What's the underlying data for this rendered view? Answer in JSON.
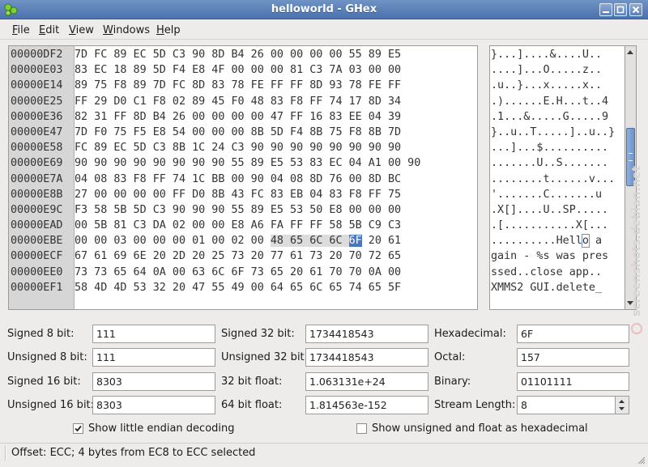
{
  "window": {
    "title": "helloworld - GHex"
  },
  "menu": {
    "file": "File",
    "edit": "Edit",
    "view": "View",
    "windows": "Windows",
    "help": "Help"
  },
  "hex_view": {
    "offsets": [
      "00000DF2",
      "00000E03",
      "00000E14",
      "00000E25",
      "00000E36",
      "00000E47",
      "00000E58",
      "00000E69",
      "00000E7A",
      "00000E8B",
      "00000E9C",
      "00000EAD",
      "00000EBE",
      "00000ECF",
      "00000EE0",
      "00000EF1"
    ],
    "hex_rows": [
      "7D FC 89 EC 5D C3 90 8D B4 26 00 00 00 00 55 89 E5",
      "83 EC 18 89 5D F4 E8 4F 00 00 00 81 C3 7A 03 00 00",
      "89 75 F8 89 7D FC 8D 83 78 FE FF FF 8D 93 78 FE FF",
      "FF 29 D0 C1 F8 02 89 45 F0 48 83 F8 FF 74 17 8D 34",
      "82 31 FF 8D B4 26 00 00 00 00 47 FF 16 83 EE 04 39",
      "7D F0 75 F5 E8 54 00 00 00 8B 5D F4 8B 75 F8 8B 7D",
      "FC 89 EC 5D C3 8B 1C 24 C3 90 90 90 90 90 90 90 90",
      "90 90 90 90 90 90 90 90 55 89 E5 53 83 EC 04 A1 00 90",
      "04 08 83 F8 FF 74 1C BB 00 90 04 08 8D 76 00 8D BC",
      "27 00 00 00 00 FF D0 8B 43 FC 83 EB 04 83 F8 FF 75",
      "F3 58 5B 5D C3 90 90 90 55 89 E5 53 50 E8 00 00 00",
      "00 5B 81 C3 DA 02 00 00 E8 A6 FA FF FF 58 5B C9 C3",
      "00 00 03 00 00 00 01 00 02 00 48 65 6C 6C 6F 20 61",
      "67 61 69 6E 20 2D 20 25 73 20 77 61 73 20 70 72 65",
      "73 73 65 64 0A 00 63 6C 6F 73 65 20 61 70 70 0A 00",
      "58 4D 4D 53 32 20 47 55 49 00 64 65 6C 65 74 65 5F"
    ],
    "selected_row_prefix": "00 00 03 00 00 00 01 00 02 00 ",
    "selected_bytes": "48 65 6C 6C ",
    "cursor_byte": "6F",
    "selected_row_suffix": " 20 61",
    "ascii_rows": [
      "}...]....&....U..",
      "....]...O.....z..",
      ".u..}...x.....x..",
      ".)......E.H...t..4",
      ".1...&.....G.....9",
      "}..u..T.....]..u..}",
      "...]...$..........",
      ".......U..S.......",
      "........t......v...",
      "'.......C.......u",
      ".X[]....U..SP.....",
      ".[...........X[...",
      "..........Hell",
      "gain - %s was pres",
      "ssed..close app..",
      "XMMS2 GUI.delete_"
    ],
    "ascii_cursor_char": "o",
    "ascii_after_cursor": " a"
  },
  "fields": {
    "signed8_label": "Signed 8 bit:",
    "signed8_value": "111",
    "unsigned8_label": "Unsigned 8 bit:",
    "unsigned8_value": "111",
    "signed16_label": "Signed 16 bit:",
    "signed16_value": "8303",
    "unsigned16_label": "Unsigned 16 bit:",
    "unsigned16_value": "8303",
    "signed32_label": "Signed 32 bit:",
    "signed32_value": "1734418543",
    "unsigned32_label": "Unsigned 32 bit:",
    "unsigned32_value": "1734418543",
    "float32_label": "32 bit float:",
    "float32_value": "1.063131e+24",
    "float64_label": "64 bit float:",
    "float64_value": "1.814563e-152",
    "hex_label": "Hexadecimal:",
    "hex_value": "6F",
    "octal_label": "Octal:",
    "octal_value": "157",
    "binary_label": "Binary:",
    "binary_value": "01101111",
    "stream_label": "Stream Length:",
    "stream_value": "8"
  },
  "options": {
    "little_endian_label": "Show little endian decoding",
    "little_endian_checked": true,
    "unsigned_hex_label": "Show unsigned and float as hexadecimal",
    "unsigned_hex_checked": false
  },
  "status": {
    "text": "Offset: ECC; 4 bytes from EC8 to ECC selected"
  },
  "watermark": {
    "text": "screenshots.debian.net"
  },
  "colors": {
    "titlebar": "#5a80b8",
    "selection": "#dcdcdc",
    "cursor": "#4a78c0"
  }
}
